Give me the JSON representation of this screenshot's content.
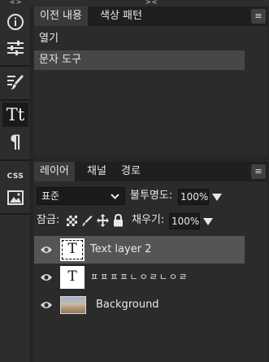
{
  "window": {
    "collapse_left": "<>",
    "collapse_right": "><"
  },
  "toolbar": {
    "tools": [
      {
        "name": "info",
        "label": "i"
      },
      {
        "name": "adjust",
        "label": ""
      },
      {
        "name": "brush-settings",
        "label": ""
      },
      {
        "name": "character",
        "label": "Tt"
      },
      {
        "name": "paragraph",
        "label": "¶"
      },
      {
        "name": "css",
        "label": "CSS"
      },
      {
        "name": "image",
        "label": ""
      }
    ]
  },
  "history_panel": {
    "tabs": [
      {
        "label": "이전 내용",
        "active": true
      },
      {
        "label": "색상 패턴",
        "active": false
      }
    ],
    "menu_label": "≡",
    "items": [
      {
        "label": "열기",
        "selected": false
      },
      {
        "label": "문자 도구",
        "selected": true
      }
    ]
  },
  "layers_panel": {
    "tabs": [
      {
        "label": "레이어",
        "active": true
      },
      {
        "label": "채널",
        "active": false
      },
      {
        "label": "경로",
        "active": false
      }
    ],
    "menu_label": "≡",
    "blend_mode": "표준",
    "opacity_label": "불투명도:",
    "opacity_value": "100%",
    "lock_label": "잠금:",
    "fill_label": "채우기:",
    "fill_value": "100%",
    "layers": [
      {
        "name": "Text layer 2",
        "thumb": "T",
        "type": "text",
        "selected": true,
        "visible": true
      },
      {
        "name": "ㅍㅍㅍㅍㄴㅇㄹㄴㅇㄹ",
        "thumb": "T",
        "type": "text",
        "selected": false,
        "visible": true
      },
      {
        "name": "Background",
        "thumb": "",
        "type": "image",
        "selected": false,
        "visible": true
      }
    ]
  }
}
